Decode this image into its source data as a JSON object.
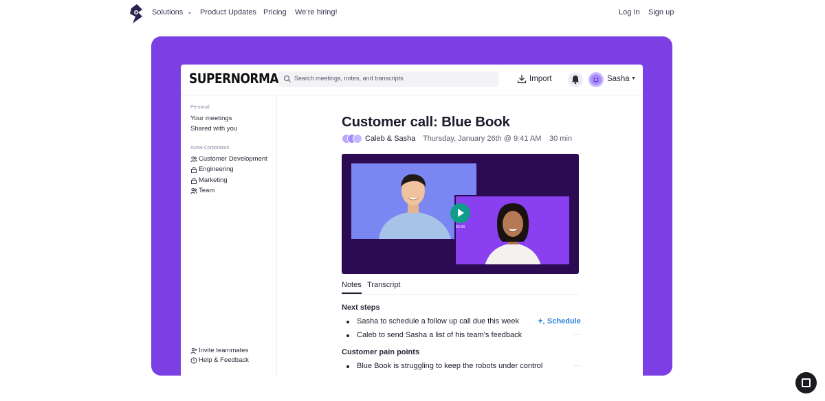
{
  "nav": {
    "solutions": "Solutions",
    "product_updates": "Product Updates",
    "pricing": "Pricing",
    "hiring": "We’re hiring!",
    "log_in": "Log In",
    "sign_up": "Sign up"
  },
  "app": {
    "brand": "SUPERNORMAL",
    "search_placeholder": "Search meetings, notes, and transcripts",
    "import_label": "Import",
    "user_name": "Sasha"
  },
  "sidebar": {
    "personal_heading": "Personal",
    "personal_items": [
      "Your meetings",
      "Shared with you"
    ],
    "org_heading": "Acme Corporation",
    "org_items": [
      "Customer Development",
      "Engineering",
      "Marketing",
      "Team"
    ],
    "footer_items": [
      "Invite teammates",
      "Help & Feedback"
    ]
  },
  "meeting": {
    "title": "Customer call: Blue Book",
    "participants": "Caleb & Sasha",
    "date": "Thursday, January 26th @ 9:41 AM",
    "duration": "30 min",
    "video_time": "30:00"
  },
  "tabs": [
    "Notes",
    "Transcript"
  ],
  "notes": {
    "section1_heading": "Next steps",
    "section1_items": [
      "Sasha to schedule a follow up call due this week",
      "Caleb to send Sasha a list of his team’s feedback"
    ],
    "schedule_label": "Schedule",
    "section2_heading": "Customer pain points",
    "section2_items": [
      "Blue Book is struggling to keep the robots under control"
    ],
    "more_label": "···"
  },
  "colors": {
    "hero": "#7b3fe4",
    "video_bg": "#2c0b52",
    "play": "#0e9e8a",
    "schedule": "#2a7fd6"
  }
}
